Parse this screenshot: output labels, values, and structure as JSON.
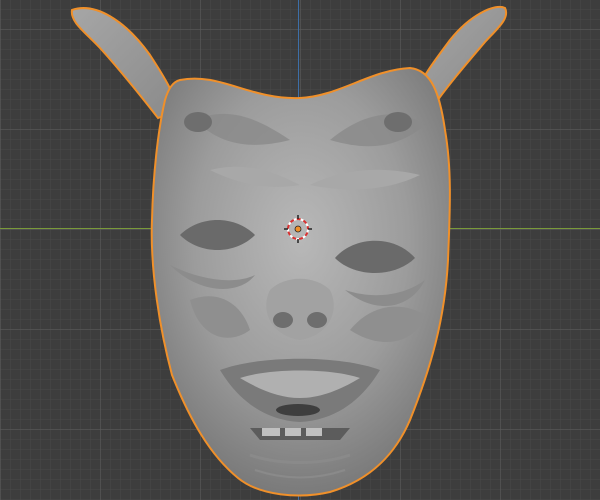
{
  "viewport": {
    "mode": "3d-viewport",
    "object": "demon-mask-sculpt",
    "selected": true,
    "colors": {
      "background": "#3d3d3d",
      "grid": "#4a4a4a",
      "x_axis": "#7a9a3a",
      "z_axis": "#3d6fa8",
      "selection_outline": "#f0902a",
      "mesh": "#9a9a9a"
    },
    "icons": [
      "3d-cursor-icon",
      "origin-point-icon"
    ]
  }
}
